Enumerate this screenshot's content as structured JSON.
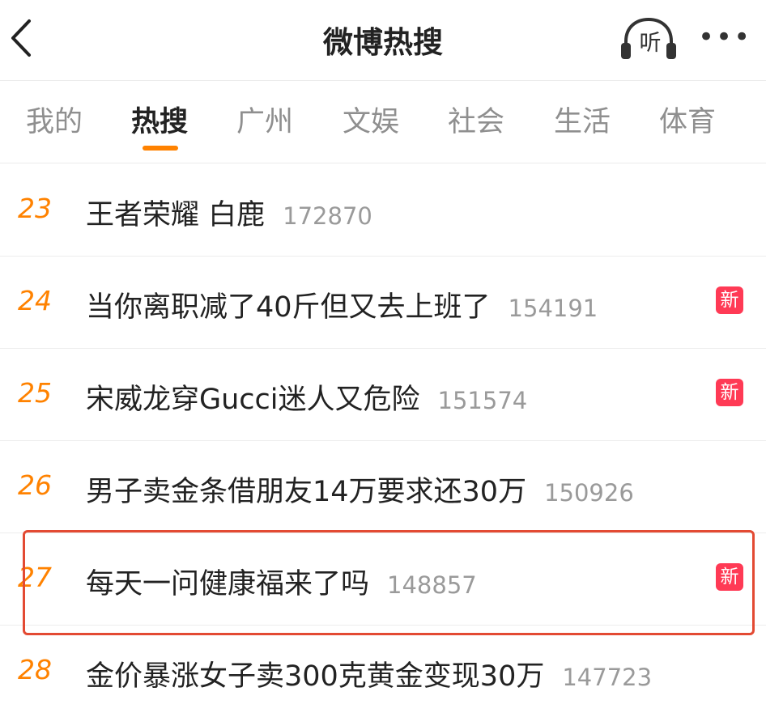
{
  "header": {
    "title": "微博热搜",
    "listen_label": "听",
    "more_label": "•••",
    "icons": {
      "back": "back-chevron-icon",
      "listen": "headphones-icon",
      "more": "more-dots-icon"
    }
  },
  "tabs": [
    {
      "label": "我的"
    },
    {
      "label": "热搜",
      "active": true
    },
    {
      "label": "广州"
    },
    {
      "label": "文娱"
    },
    {
      "label": "社会"
    },
    {
      "label": "生活"
    },
    {
      "label": "体育"
    }
  ],
  "rows": [
    {
      "rank": "23",
      "title": "王者荣耀 白鹿",
      "count": "172870"
    },
    {
      "rank": "24",
      "title": "当你离职减了40斤但又去上班了",
      "count": "154191",
      "badge": "新"
    },
    {
      "rank": "25",
      "title": "宋威龙穿Gucci迷人又危险",
      "count": "151574",
      "badge": "新"
    },
    {
      "rank": "26",
      "title": "男子卖金条借朋友14万要求还30万",
      "count": "150926"
    },
    {
      "rank": "27",
      "title": "每天一问健康福来了吗",
      "count": "148857",
      "badge": "新"
    },
    {
      "rank": "28",
      "title": "金价暴涨女子卖300克黄金变现30万",
      "count": "147723"
    }
  ],
  "colors": {
    "accent": "#ff8200",
    "badge": "#ff3a55",
    "highlight_box": "#e34a33"
  }
}
